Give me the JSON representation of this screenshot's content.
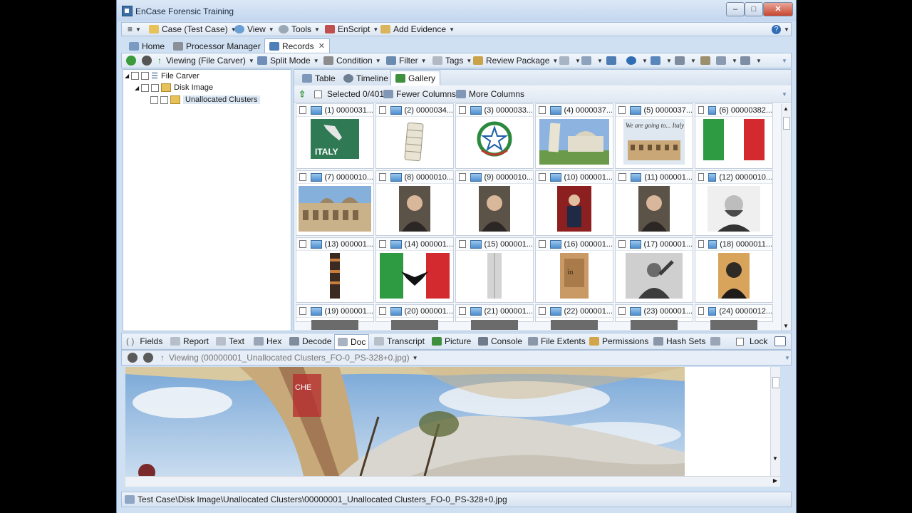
{
  "window": {
    "title": "EnCase Forensic Training"
  },
  "menubar": {
    "items": [
      {
        "label": "Case (Test Case)",
        "icon": "case-icon"
      },
      {
        "label": "View",
        "icon": "view-icon"
      },
      {
        "label": "Tools",
        "icon": "tools-icon"
      },
      {
        "label": "EnScript",
        "icon": "enscript-icon"
      },
      {
        "label": "Add Evidence",
        "icon": "add-evidence-icon"
      }
    ]
  },
  "main_tabs": [
    {
      "label": "Home"
    },
    {
      "label": "Processor Manager"
    },
    {
      "label": "Records",
      "active": true
    }
  ],
  "toolbar": {
    "viewing": "Viewing (File Carver)",
    "split_mode": "Split Mode",
    "condition": "Condition",
    "filter": "Filter",
    "tags": "Tags",
    "review_package": "Review Package"
  },
  "tree": {
    "root": "File Carver",
    "child": "Disk Image",
    "leaf": "Unallocated Clusters"
  },
  "view_tabs": [
    {
      "label": "Table"
    },
    {
      "label": "Timeline"
    },
    {
      "label": "Gallery",
      "active": true
    }
  ],
  "gallery_toolbar": {
    "selected": "Selected 0/401",
    "fewer_columns": "Fewer Columns",
    "more_columns": "More Columns"
  },
  "gallery": [
    {
      "label": "(1) 0000031...",
      "thumb": "italy-map"
    },
    {
      "label": "(2) 0000034...",
      "thumb": "pisa-tower"
    },
    {
      "label": "(3) 0000033...",
      "thumb": "emblem"
    },
    {
      "label": "(4) 0000037...",
      "thumb": "pisa-square"
    },
    {
      "label": "(5) 0000037...",
      "thumb": "colosseum"
    },
    {
      "label": "(6) 00000382...",
      "thumb": "italian-flag"
    },
    {
      "label": "(7) 0000010...",
      "thumb": "venice"
    },
    {
      "label": "(8) 0000010...",
      "thumb": "portrait"
    },
    {
      "label": "(9) 0000010...",
      "thumb": "portrait"
    },
    {
      "label": "(10) 000001...",
      "thumb": "portrait-red"
    },
    {
      "label": "(11) 000001...",
      "thumb": "portrait"
    },
    {
      "label": "(12) 0000010...",
      "thumb": "portrait-bw"
    },
    {
      "label": "(13) 000001...",
      "thumb": "strip"
    },
    {
      "label": "(14) 000001...",
      "thumb": "flag-eagle"
    },
    {
      "label": "(15) 000001...",
      "thumb": "gray-strip"
    },
    {
      "label": "(16) 000001...",
      "thumb": "book"
    },
    {
      "label": "(17) 000001...",
      "thumb": "speech"
    },
    {
      "label": "(18) 0000011...",
      "thumb": "portrait-dark"
    },
    {
      "label": "(19) 000001...",
      "thumb": "partial"
    },
    {
      "label": "(20) 000001...",
      "thumb": "partial"
    },
    {
      "label": "(21) 000001...",
      "thumb": "partial"
    },
    {
      "label": "(22) 000001...",
      "thumb": "partial"
    },
    {
      "label": "(23) 000001...",
      "thumb": "partial"
    },
    {
      "label": "(24) 0000012...",
      "thumb": "partial"
    }
  ],
  "thumb_text": {
    "italy": "ITALY",
    "colosseum": "We are going to... Italy!",
    "book": "in"
  },
  "lower_tabs": [
    {
      "label": "Fields"
    },
    {
      "label": "Report"
    },
    {
      "label": "Text"
    },
    {
      "label": "Hex"
    },
    {
      "label": "Decode"
    },
    {
      "label": "Doc",
      "active": true
    },
    {
      "label": "Transcript"
    },
    {
      "label": "Picture"
    },
    {
      "label": "Console"
    },
    {
      "label": "File Extents"
    },
    {
      "label": "Permissions"
    },
    {
      "label": "Hash Sets"
    },
    {
      "label": "Lock"
    }
  ],
  "viewer": {
    "viewing": "Viewing (00000001_Unallocated Clusters_FO-0_PS-328+0.jpg)"
  },
  "picture_text": {
    "banner": "CHE"
  },
  "status": {
    "path": "Test Case\\Disk Image\\Unallocated Clusters\\00000001_Unallocated Clusters_FO-0_PS-328+0.jpg"
  }
}
